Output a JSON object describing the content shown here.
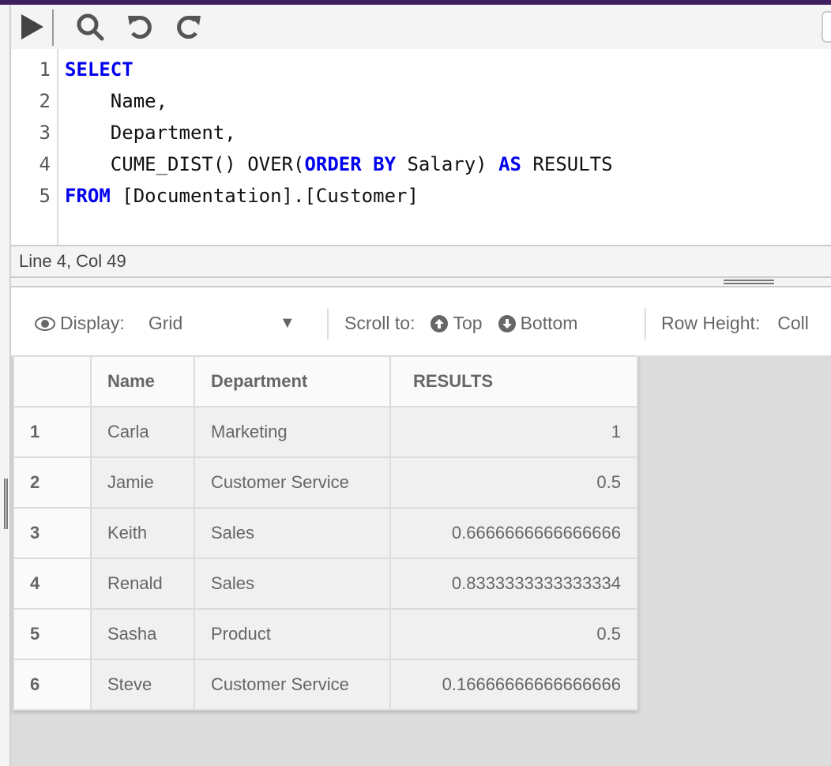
{
  "toolbar": {
    "icons": [
      "play-icon",
      "search-icon",
      "undo-icon",
      "redo-icon"
    ]
  },
  "editor": {
    "line_numbers": [
      "1",
      "2",
      "3",
      "4",
      "5"
    ],
    "lines": [
      [
        {
          "t": "SELECT",
          "k": true
        }
      ],
      [
        {
          "t": "    Name,",
          "k": false
        }
      ],
      [
        {
          "t": "    Department,",
          "k": false
        }
      ],
      [
        {
          "t": "    CUME_DIST() OVER(",
          "k": false
        },
        {
          "t": "ORDER BY",
          "k": true
        },
        {
          "t": " Salary) ",
          "k": false
        },
        {
          "t": "AS",
          "k": true
        },
        {
          "t": " RESULTS",
          "k": false
        }
      ],
      [
        {
          "t": "FROM",
          "k": true
        },
        {
          "t": " [Documentation].[Customer]",
          "k": false
        }
      ]
    ],
    "keyword_color": "#0000ee"
  },
  "status": {
    "cursor": "Line 4, Col 49"
  },
  "options": {
    "display_label": "Display:",
    "display_value": "Grid",
    "scroll_label": "Scroll to:",
    "top_label": "Top",
    "bottom_label": "Bottom",
    "row_height_label": "Row Height:",
    "row_height_value": "Coll"
  },
  "grid": {
    "columns": [
      "",
      "Name",
      "Department",
      "RESULTS"
    ],
    "rows": [
      [
        "1",
        "Carla",
        "Marketing",
        "1"
      ],
      [
        "2",
        "Jamie",
        "Customer Service",
        "0.5"
      ],
      [
        "3",
        "Keith",
        "Sales",
        "0.6666666666666666"
      ],
      [
        "4",
        "Renald",
        "Sales",
        "0.8333333333333334"
      ],
      [
        "5",
        "Sasha",
        "Product",
        "0.5"
      ],
      [
        "6",
        "Steve",
        "Customer Service",
        "0.16666666666666666"
      ]
    ]
  }
}
